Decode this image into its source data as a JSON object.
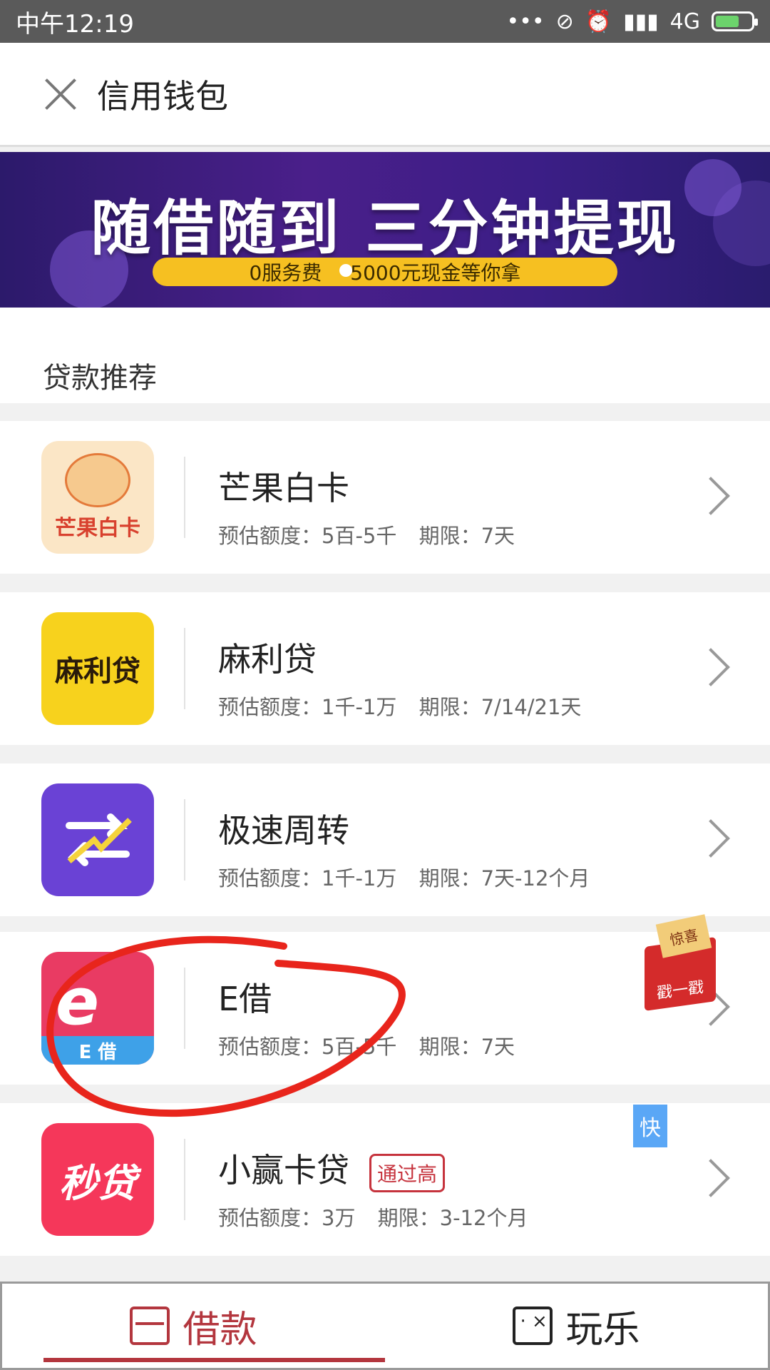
{
  "status_bar": {
    "time": "中午12:19",
    "icons": [
      "more-dots-icon",
      "mute-icon",
      "alarm-icon",
      "hd-signal-icon",
      "battery-icon"
    ],
    "network": "4G"
  },
  "header": {
    "title": "信用钱包"
  },
  "banner": {
    "headline": "随借随到 三分钟提现",
    "pill_left": "0服务费",
    "pill_right": "5000元现金等你拿"
  },
  "section": {
    "title": "贷款推荐"
  },
  "loans": [
    {
      "name": "芒果白卡",
      "limit": "预估额度：5百-5千",
      "term": "期限：7天",
      "logo_text": "芒果白卡"
    },
    {
      "name": "麻利贷",
      "limit": "预估额度：1千-1万",
      "term": "期限：7/14/21天",
      "logo_text": "麻利贷"
    },
    {
      "name": "极速周转",
      "limit": "预估额度：1千-1万",
      "term": "期限：7天-12个月",
      "logo_text": ""
    },
    {
      "name": "E借",
      "limit": "预估额度：5百-5千",
      "term": "期限：7天",
      "logo_text": "E 借"
    },
    {
      "name": "小赢卡贷",
      "badge": "通过高",
      "limit": "预估额度：3万",
      "term": "期限：3-12个月",
      "logo_text": "秒贷"
    }
  ],
  "promo": {
    "ticket_text": "惊喜",
    "box_text": "戳一戳"
  },
  "kuai_badge": "快",
  "tabs": [
    {
      "label": "借款",
      "active": true
    },
    {
      "label": "玩乐",
      "active": false
    }
  ],
  "colors": {
    "accent": "#b3363e",
    "banner": "#3b1e86",
    "pill": "#f6c021"
  }
}
